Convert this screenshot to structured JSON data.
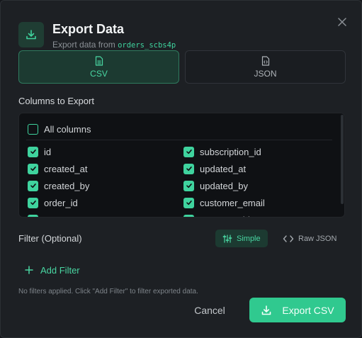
{
  "dialog": {
    "title": "Export Data",
    "subtitle_prefix": "Export data from",
    "table_name": "orders_scbs4p"
  },
  "formats": [
    {
      "label": "CSV",
      "icon": "csv-file-icon",
      "selected": true
    },
    {
      "label": "JSON",
      "icon": "json-file-icon",
      "selected": false
    }
  ],
  "columns_section": {
    "label": "Columns to Export",
    "all_label": "All columns",
    "all_checked": false,
    "left": [
      {
        "name": "id",
        "checked": true
      },
      {
        "name": "created_at",
        "checked": true
      },
      {
        "name": "created_by",
        "checked": true
      },
      {
        "name": "order_id",
        "checked": true
      },
      {
        "name": "status",
        "checked": true
      }
    ],
    "right": [
      {
        "name": "subscription_id",
        "checked": true
      },
      {
        "name": "updated_at",
        "checked": true
      },
      {
        "name": "updated_by",
        "checked": true
      },
      {
        "name": "customer_email",
        "checked": true
      },
      {
        "name": "customer_id",
        "checked": true
      }
    ]
  },
  "filter": {
    "label": "Filter (Optional)",
    "modes": [
      {
        "label": "Simple",
        "icon": "sliders-icon",
        "active": true
      },
      {
        "label": "Raw JSON",
        "icon": "code-icon",
        "active": false
      }
    ],
    "add_label": "Add Filter",
    "hint": "No filters applied. Click \"Add Filter\" to filter exported data."
  },
  "actions": {
    "cancel_label": "Cancel",
    "export_label": "Export CSV"
  },
  "colors": {
    "accent": "#3fd39e",
    "accent_dark": "#1c3a31",
    "background": "#1d2024"
  }
}
